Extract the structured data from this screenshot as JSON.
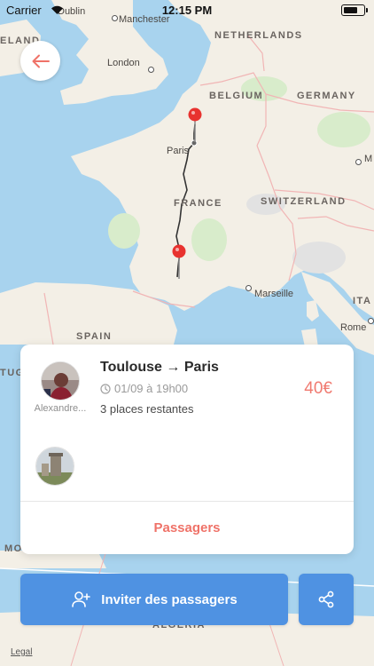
{
  "status_bar": {
    "carrier": "Carrier",
    "time": "12:15 PM",
    "battery_level": 0.75
  },
  "map": {
    "labels": {
      "dublin": "Dublin",
      "manchester": "Manchester",
      "ireland": "ELAND",
      "netherlands": "NETHERLANDS",
      "london": "London",
      "belgium": "BELGIUM",
      "germany": "GERMANY",
      "paris": "Paris",
      "munich": "M",
      "france": "FRANCE",
      "switzerland": "SWITZERLAND",
      "marseille": "Marseille",
      "spain": "SPAIN",
      "italy": "ITA",
      "rome": "Rome",
      "portugal": "TUG",
      "morocco": "MO",
      "algeria": "ALGERIA"
    },
    "pin_color": "#e8322f",
    "route_color": "#333333"
  },
  "trip": {
    "driver_name": "Alexandre...",
    "route": "Toulouse → Paris",
    "date": "01/09 à 19h00",
    "seats": "3 places restantes",
    "price": "40€",
    "passengers_label": "Passagers"
  },
  "actions": {
    "invite_label": "Inviter des passagers"
  },
  "legal": "Legal",
  "colors": {
    "accent": "#ef7268",
    "primary": "#4f92e2"
  }
}
